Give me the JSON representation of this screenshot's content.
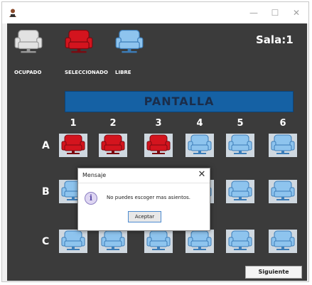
{
  "window": {
    "title_icon": "app-user-icon",
    "controls": {
      "minimize": "—",
      "maximize": "☐",
      "close": "✕"
    }
  },
  "legend": [
    {
      "label": "OCUPADO",
      "state": "occupied",
      "color": "#e2e2e2"
    },
    {
      "label": "SELECCIONADO",
      "state": "selected",
      "color": "#d4141e"
    },
    {
      "label": "LIBRE",
      "state": "free",
      "color": "#8ec4ee"
    }
  ],
  "sala_label": "Sala:1",
  "screen_label": "PANTALLA",
  "columns": [
    "1",
    "2",
    "3",
    "4",
    "5",
    "6"
  ],
  "rows": [
    {
      "label": "A",
      "seats": [
        "selected",
        "selected",
        "selected",
        "free",
        "free",
        "free"
      ]
    },
    {
      "label": "B",
      "seats": [
        "free",
        "free",
        "free",
        "free",
        "free",
        "free"
      ]
    },
    {
      "label": "C",
      "seats": [
        "free",
        "free",
        "free",
        "free",
        "free",
        "free"
      ]
    }
  ],
  "next_button": "Siguiente",
  "dialog": {
    "title": "Mensaje",
    "close": "✕",
    "icon": "info-icon",
    "icon_glyph": "i",
    "message": "No puedes escoger mas asientos.",
    "button": "Aceptar"
  },
  "colors": {
    "background": "#3b3b3b",
    "screen": "#1561a4",
    "selected": "#d4141e",
    "free": "#8ec4ee",
    "occupied": "#e2e2e2"
  }
}
